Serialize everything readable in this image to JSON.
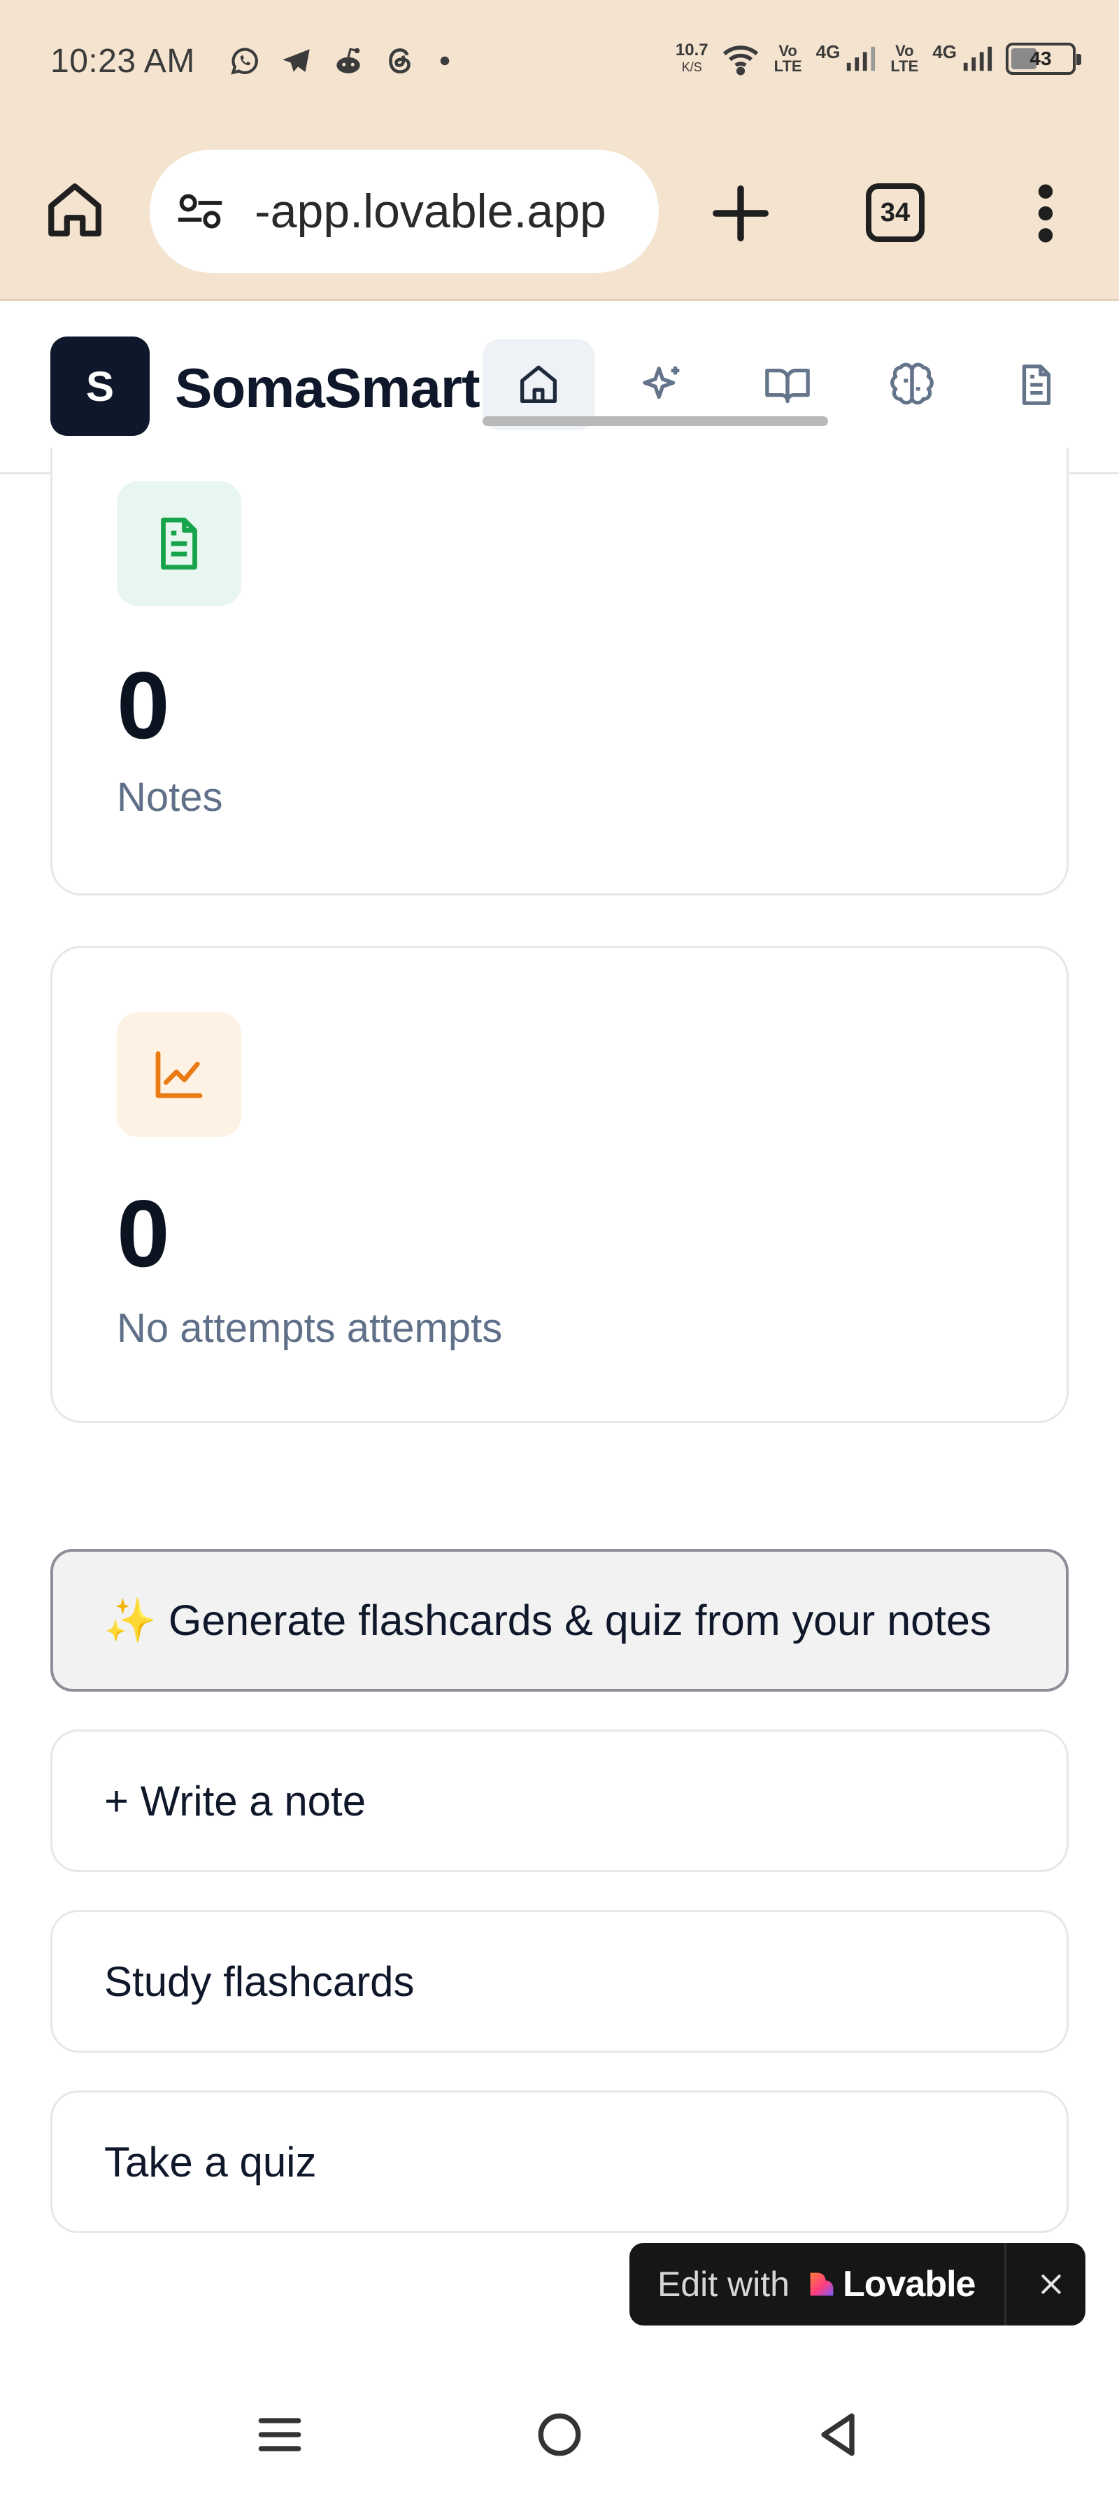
{
  "status_bar": {
    "time": "10:23 AM",
    "app_icons": [
      "whatsapp-icon",
      "telegram-icon",
      "reddit-icon",
      "threads-icon",
      "dot-icon"
    ],
    "speed_value": "10.7",
    "speed_unit": "K/S",
    "volte1": "Vo LTE",
    "net1": "4G",
    "volte2": "Vo LTE",
    "net2": "4G",
    "battery": "43",
    "battery_fraction": 0.43
  },
  "browser": {
    "url": "-app.lovable.app",
    "tab_count": "34"
  },
  "app": {
    "logo_letter": "S",
    "name": "SomaSmart",
    "nav": [
      {
        "icon": "home-icon",
        "active": true
      },
      {
        "icon": "sparkles-icon",
        "active": false
      },
      {
        "icon": "book-open-icon",
        "active": false
      },
      {
        "icon": "brain-icon",
        "active": false
      },
      {
        "icon": "file-text-icon",
        "active": false
      }
    ]
  },
  "stats": {
    "notes": {
      "value": "0",
      "label": "Notes",
      "icon": "file-text-icon",
      "color": "#16a34a"
    },
    "attempts": {
      "value": "0",
      "label": "No attempts attempts",
      "icon": "chart-line-icon",
      "color": "#ea7a12"
    }
  },
  "actions": {
    "generate": "✨ Generate flashcards & quiz from your notes",
    "write_note": "+ Write a note",
    "study_flashcards": "Study flashcards",
    "take_quiz": "Take a quiz"
  },
  "lovable_badge": {
    "prefix": "Edit with",
    "brand": "Lovable"
  },
  "colors": {
    "chrome_bg": "#f4e3ce",
    "brand_dark": "#0f172a",
    "muted_text": "#607089"
  }
}
